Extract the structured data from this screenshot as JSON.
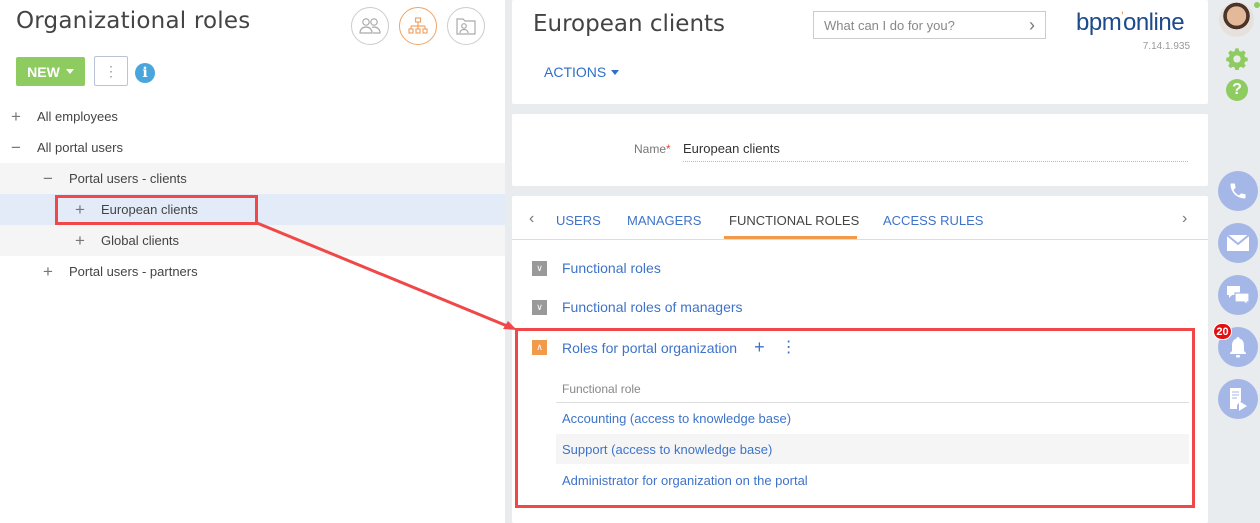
{
  "left_panel": {
    "title": "Organizational roles",
    "view_icons": [
      {
        "name": "users-view-icon",
        "active": false
      },
      {
        "name": "org-chart-view-icon",
        "active": true
      },
      {
        "name": "folder-user-view-icon",
        "active": false
      }
    ],
    "new_button": "NEW",
    "more_button": "⋮",
    "info_icon": "i",
    "tree": [
      {
        "label": "All employees",
        "toggle": "+",
        "level": 0,
        "style": ""
      },
      {
        "label": "All portal users",
        "toggle": "−",
        "level": 0,
        "style": ""
      },
      {
        "label": "Portal users - clients",
        "toggle": "−",
        "level": 1,
        "style": "band"
      },
      {
        "label": "European clients",
        "toggle": "+",
        "level": 2,
        "style": "selected"
      },
      {
        "label": "Global clients",
        "toggle": "+",
        "level": 2,
        "style": "band"
      },
      {
        "label": "Portal users - partners",
        "toggle": "+",
        "level": 1,
        "style": ""
      }
    ]
  },
  "header": {
    "record_title": "European clients",
    "command_placeholder": "What can I do for you?",
    "command_go": "›",
    "logo_text_a": "bpm",
    "logo_dot": "'",
    "logo_text_b": "online",
    "version": "7.14.1.935",
    "actions_label": "ACTIONS"
  },
  "name_field": {
    "label": "Name",
    "required_mark": "*",
    "value": "European clients"
  },
  "tabs": {
    "prev": "‹",
    "next": "›",
    "items": [
      "USERS",
      "MANAGERS",
      "FUNCTIONAL ROLES",
      "ACCESS RULES"
    ],
    "active_index": 2
  },
  "details": [
    {
      "label": "Functional roles",
      "expanded": false
    },
    {
      "label": "Functional roles of managers",
      "expanded": false
    },
    {
      "label": "Roles for portal organization",
      "expanded": true,
      "add": "+",
      "menu": "⋮"
    }
  ],
  "grid": {
    "column_header": "Functional role",
    "rows": [
      "Accounting (access to knowledge base)",
      "Support (access to knowledge base)",
      "Administrator for organization on the portal"
    ]
  },
  "right_bar": {
    "notification_count": "20",
    "comm_buttons": [
      "phone",
      "email",
      "chat",
      "notifications",
      "feed"
    ]
  },
  "colors": {
    "accent_green": "#8ecb60",
    "link_blue": "#3e73c9",
    "active_orange": "#f29a4b",
    "annotation_red": "#f04848",
    "comm_blue": "#a5b7e6"
  }
}
